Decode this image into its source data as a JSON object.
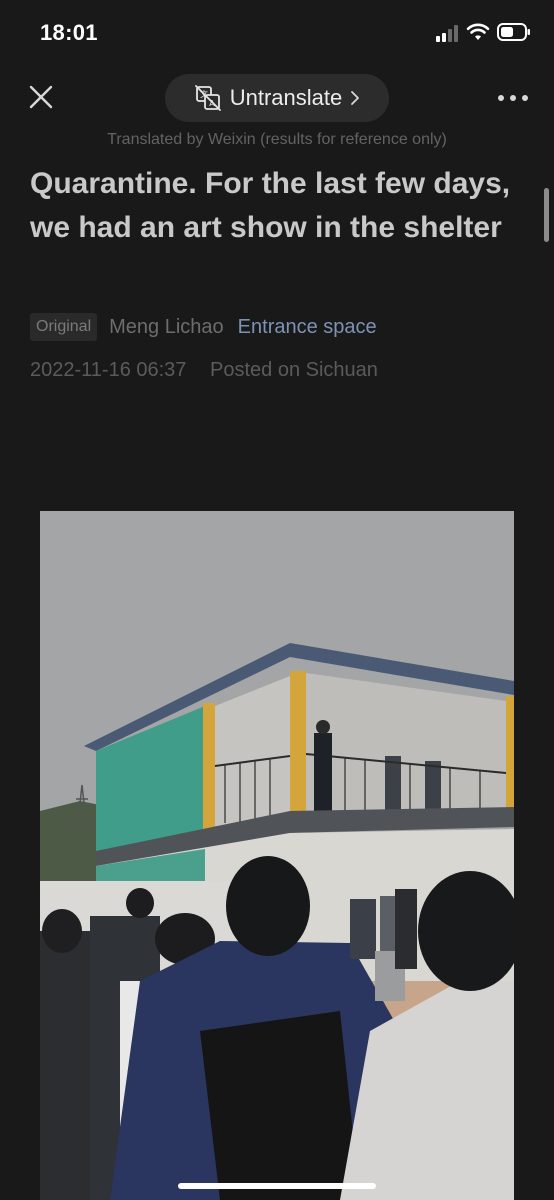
{
  "status_bar": {
    "time": "18:01",
    "icons": [
      "signal-icon",
      "wifi-icon",
      "battery-icon"
    ]
  },
  "nav": {
    "close_icon": "close-icon",
    "untranslate_label": "Untranslate",
    "translate_icon": "translate-icon",
    "chevron_icon": "chevron-right-icon",
    "more_icon": "more-icon",
    "translated_note": "Translated by Weixin (results for reference only)"
  },
  "article": {
    "title": "Quarantine. For the last few days, we had an art show in the shelter",
    "badge": "Original",
    "author": "Meng Lichao",
    "account": "Entrance space",
    "date": "2022-11-16 06:37",
    "location": "Posted on Sichuan"
  },
  "photo": {
    "subject": "people-queueing-outside-two-story-prefab-building"
  },
  "colors": {
    "background": "#191919",
    "accent_link": "#7e93b3",
    "pill": "#2c2c2c"
  }
}
